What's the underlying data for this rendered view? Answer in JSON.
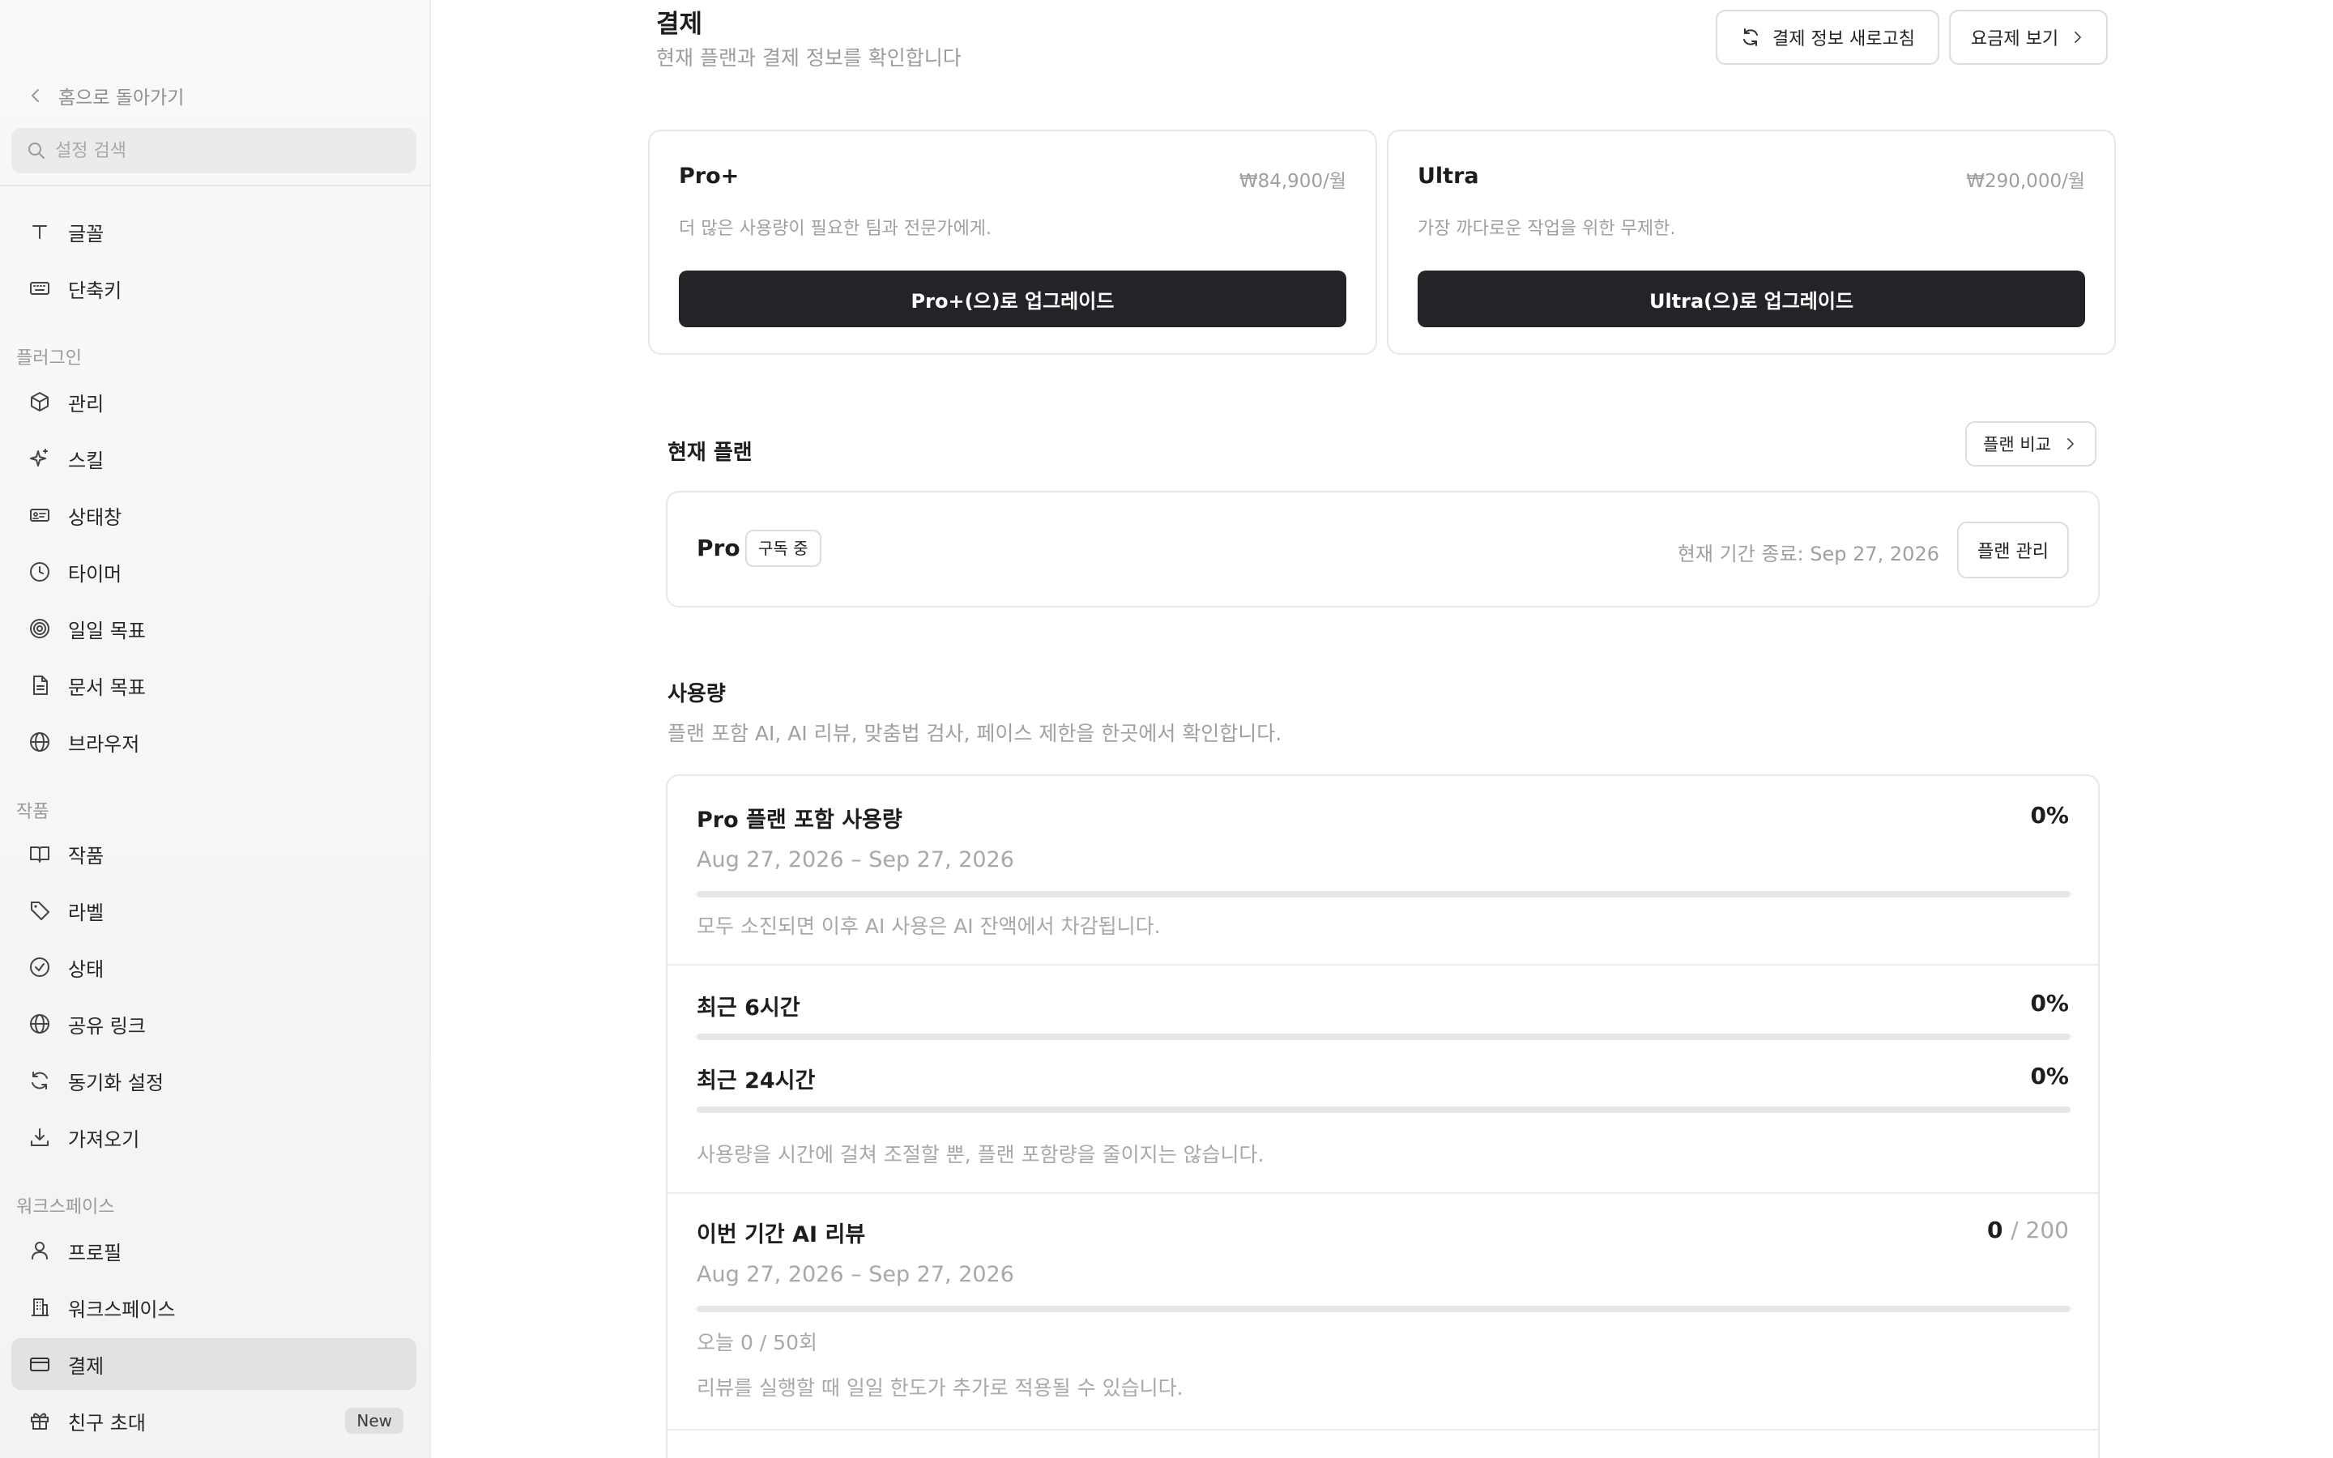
{
  "sidebar": {
    "back_label": "홈으로 돌아가기",
    "search_placeholder": "설정 검색",
    "items_top": [
      {
        "label": "글꼴",
        "icon": "type-icon"
      },
      {
        "label": "단축키",
        "icon": "keyboard-icon"
      }
    ],
    "section_plugins": "플러그인",
    "items_plugins": [
      {
        "label": "관리",
        "icon": "cube-icon"
      },
      {
        "label": "스킬",
        "icon": "sparkle-icon"
      },
      {
        "label": "상태창",
        "icon": "status-card-icon"
      },
      {
        "label": "타이머",
        "icon": "clock-icon"
      },
      {
        "label": "일일 목표",
        "icon": "target-icon"
      },
      {
        "label": "문서 목표",
        "icon": "document-icon"
      },
      {
        "label": "브라우저",
        "icon": "globe-icon"
      }
    ],
    "section_works": "작품",
    "items_works": [
      {
        "label": "작품",
        "icon": "book-icon"
      },
      {
        "label": "라벨",
        "icon": "tag-icon"
      },
      {
        "label": "상태",
        "icon": "check-circle-icon"
      },
      {
        "label": "공유 링크",
        "icon": "globe-icon"
      },
      {
        "label": "동기화 설정",
        "icon": "sync-icon"
      },
      {
        "label": "가져오기",
        "icon": "download-icon"
      }
    ],
    "section_workspace": "워크스페이스",
    "items_workspace": [
      {
        "label": "프로필",
        "icon": "user-icon"
      },
      {
        "label": "워크스페이스",
        "icon": "building-icon"
      },
      {
        "label": "결제",
        "icon": "credit-card-icon",
        "active": true
      },
      {
        "label": "친구 초대",
        "icon": "gift-icon",
        "badge": "New"
      }
    ]
  },
  "header": {
    "title": "결제",
    "subtitle": "현재 플랜과 결제 정보를 확인합니다",
    "refresh_label": "결제 정보 새로고침",
    "pricing_label": "요금제 보기"
  },
  "plans": [
    {
      "name": "Pro+",
      "price": "₩84,900/월",
      "desc": "더 많은 사용량이 필요한 팀과 전문가에게.",
      "button": "Pro+(으)로 업그레이드"
    },
    {
      "name": "Ultra",
      "price": "₩290,000/월",
      "desc": "가장 까다로운 작업을 위한 무제한.",
      "button": "Ultra(으)로 업그레이드"
    }
  ],
  "current_plan": {
    "section_title": "현재 플랜",
    "compare_label": "플랜 비교",
    "name": "Pro",
    "badge": "구독 중",
    "period": "현재 기간 종료: Sep 27, 2026",
    "manage_label": "플랜 관리"
  },
  "usage": {
    "section_title": "사용량",
    "section_sub": "플랜 포함 AI, AI 리뷰, 맞춤법 검사, 페이스 제한을 한곳에서 확인합니다.",
    "included": {
      "label": "Pro 플랜 포함 사용량",
      "value": "0%",
      "fraction": 0,
      "period": "Aug 27, 2026 – Sep 27, 2026",
      "note": "모두 소진되면 이후 AI 사용은 AI 잔액에서 차감됩니다."
    },
    "last6": {
      "label": "최근 6시간",
      "value": "0%",
      "fraction": 0
    },
    "last24": {
      "label": "최근 24시간",
      "value": "0%",
      "fraction": 0,
      "note": "사용량을 시간에 걸쳐 조절할 뿐, 플랜 포함량을 줄이지는 않습니다."
    },
    "review": {
      "label": "이번 기간 AI 리뷰",
      "used": "0",
      "total": "/ 200",
      "fraction": 0,
      "period": "Aug 27, 2026 – Sep 27, 2026",
      "today": "오늘 0 / 50회",
      "note": "리뷰를 실행할 때 일일 한도가 추가로 적용될 수 있습니다."
    }
  }
}
